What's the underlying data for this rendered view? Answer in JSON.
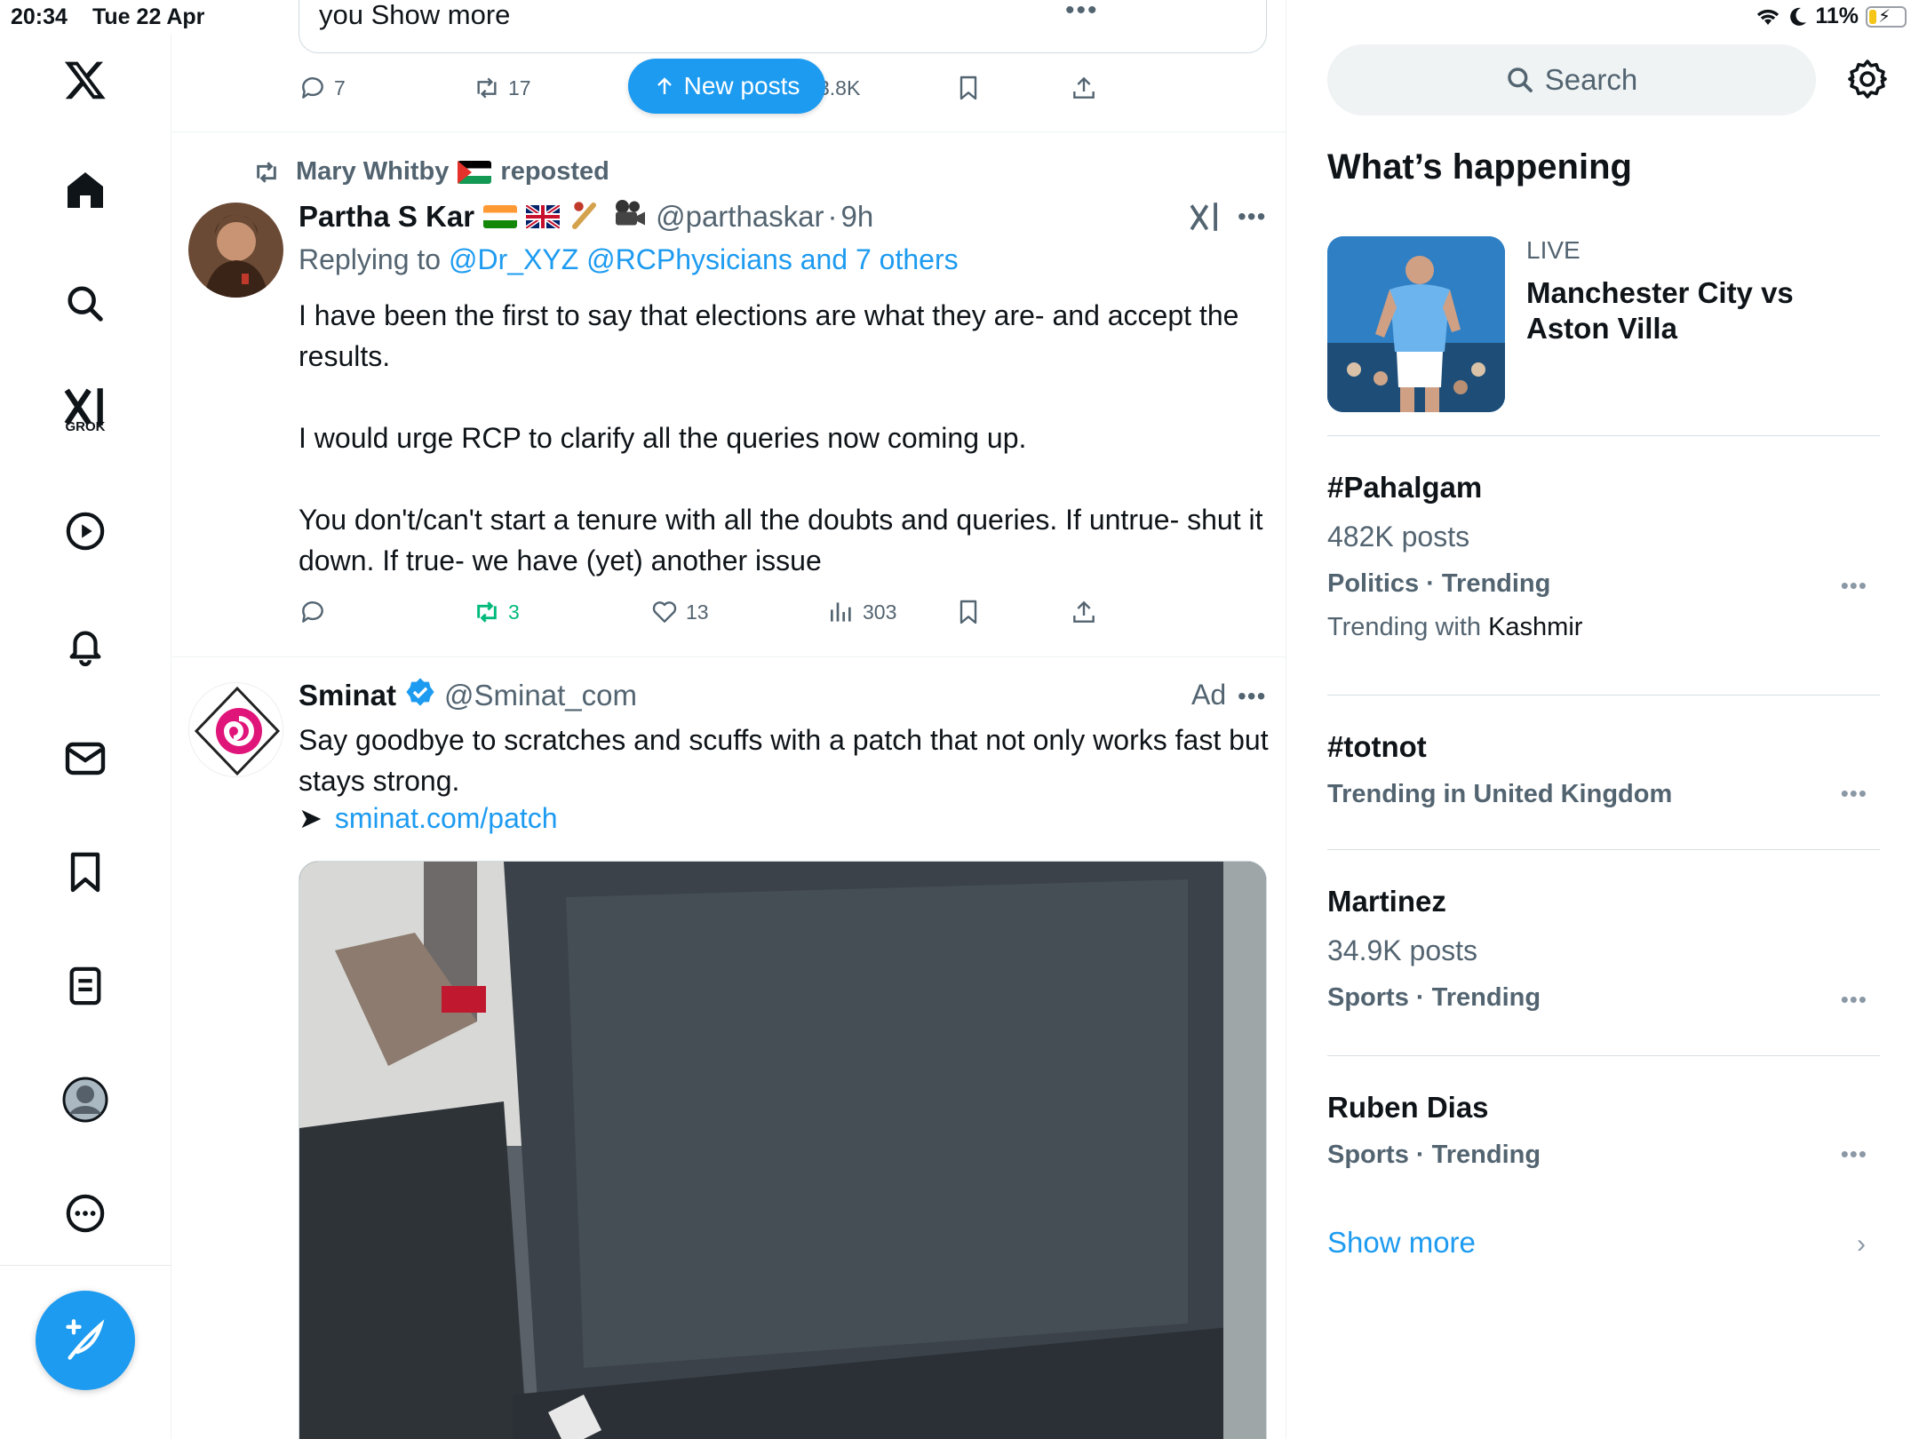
{
  "status_bar": {
    "time": "20:34",
    "date": "Tue 22 Apr",
    "battery": "11%"
  },
  "nav": {
    "items": [
      "home",
      "explore",
      "grok",
      "video",
      "notifications",
      "messages",
      "bookmarks",
      "lists",
      "profile",
      "more"
    ],
    "grok_label": "GROK"
  },
  "feed": {
    "prev_tweet": {
      "truncated_text": "you Show more",
      "replies": "7",
      "reposts": "17",
      "views": "3.8K"
    },
    "new_posts_label": "New posts",
    "tweet1": {
      "repost_by": "Mary Whitby",
      "repost_suffix": "reposted",
      "name": "Partha S Kar",
      "handle": "@parthaskar",
      "time": "9h",
      "replying_prefix": "Replying to",
      "replying_to": "@Dr_XYZ @RCPhysicians and 7 others",
      "paragraphs": [
        "I have been the first to say that elections are what they are- and accept the results.",
        "I would urge RCP to clarify all the queries now coming up.",
        "You don't/can't start a tenure with all the doubts and queries. If untrue- shut it down. If true- we have (yet) another issue"
      ],
      "replies": "",
      "reposts": "3",
      "likes": "13",
      "views": "303"
    },
    "ad": {
      "name": "Sminat",
      "handle": "@Sminat_com",
      "label": "Ad",
      "text": "Say goodbye to scratches and scuffs with a patch that not only works fast but stays strong.",
      "arrow": "➤",
      "link": "sminat.com/patch"
    }
  },
  "sidebar": {
    "search_placeholder": "Search",
    "title": "What’s happening",
    "live": {
      "label": "LIVE",
      "title": "Manchester City vs Aston Villa"
    },
    "trends": [
      {
        "name": "#Pahalgam",
        "posts": "482K posts",
        "category": "Politics · Trending",
        "with_prefix": "Trending with",
        "with": "Kashmir"
      },
      {
        "name": "#totnot",
        "category": "Trending in United Kingdom"
      },
      {
        "name": "Martinez",
        "posts": "34.9K posts",
        "category": "Sports · Trending"
      },
      {
        "name": "Ruben Dias",
        "category": "Sports · Trending"
      }
    ],
    "show_more": "Show more"
  },
  "colors": {
    "accent": "#1d9bf0",
    "repost_green": "#00ba7c",
    "muted": "#536471"
  }
}
